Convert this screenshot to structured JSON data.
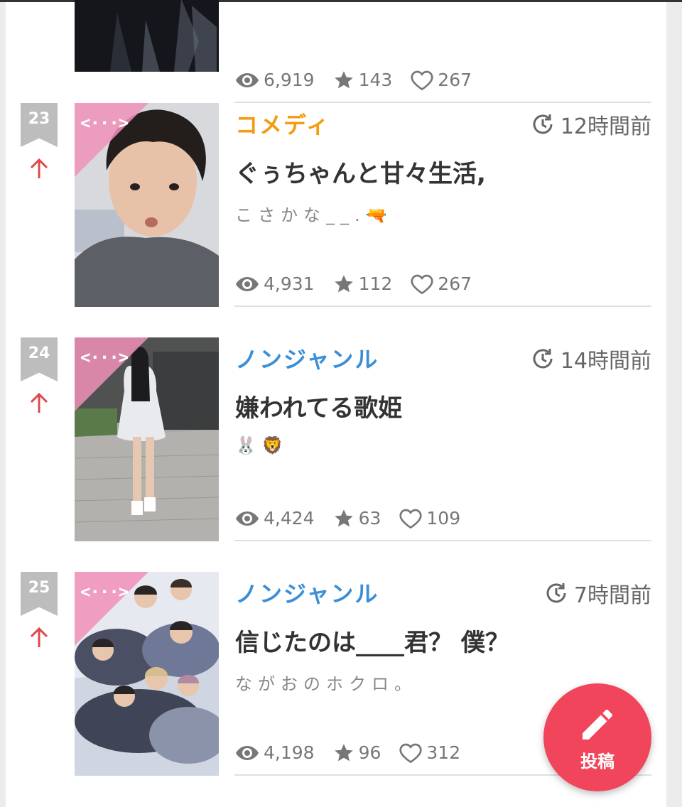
{
  "items": [
    {
      "stats": {
        "views": "6,919",
        "stars": "143",
        "likes": "267"
      }
    },
    {
      "rank": "23",
      "genre": "コメディ",
      "genre_color": "#f39c12",
      "time": "12時間前",
      "title": "ぐぅちゃんと甘々生活,",
      "author": "こさかな__.🔫",
      "stats": {
        "views": "4,931",
        "stars": "112",
        "likes": "267"
      }
    },
    {
      "rank": "24",
      "genre": "ノンジャンル",
      "genre_color": "#3b8fd6",
      "time": "14時間前",
      "title": "嫌われてる歌姫",
      "author": "🐰🦁",
      "stats": {
        "views": "4,424",
        "stars": "63",
        "likes": "109"
      }
    },
    {
      "rank": "25",
      "genre": "ノンジャンル",
      "genre_color": "#3b8fd6",
      "time": "7時間前",
      "title": "信じたのは____君？ 僕？",
      "author": "ながおのホクロ。",
      "stats": {
        "views": "4,198",
        "stars": "96",
        "likes": "312"
      }
    }
  ],
  "icons": {
    "rank_up": "arrow-up-icon",
    "time": "clock-refresh-icon",
    "views": "eye-icon",
    "stars": "star-icon",
    "likes": "heart-icon",
    "post": "pencil-icon"
  },
  "fab": {
    "label": "投稿",
    "color": "#f0455a"
  },
  "ribbon_glyph": "<···>"
}
